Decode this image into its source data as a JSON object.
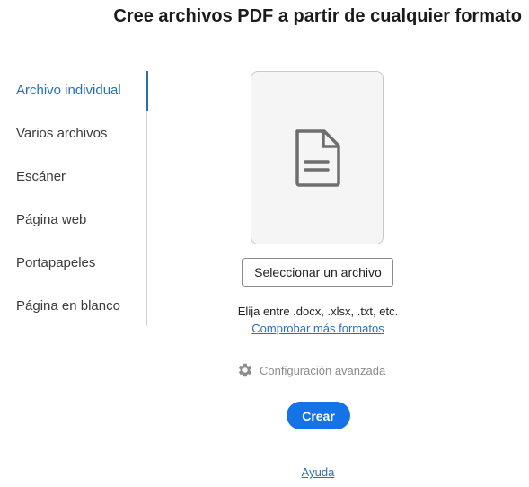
{
  "header": {
    "title": "Cree archivos PDF a partir de cualquier formato"
  },
  "sidebar": {
    "items": [
      {
        "label": "Archivo individual",
        "active": true
      },
      {
        "label": "Varios archivos",
        "active": false
      },
      {
        "label": "Escáner",
        "active": false
      },
      {
        "label": "Página web",
        "active": false
      },
      {
        "label": "Portapapeles",
        "active": false
      },
      {
        "label": "Página en blanco",
        "active": false
      }
    ]
  },
  "main": {
    "dropzone_icon": "document-icon",
    "select_button_label": "Seleccionar un archivo",
    "formats_text": "Elija entre .docx, .xlsx, .txt, etc.",
    "formats_link": "Comprobar más formatos",
    "advanced_settings_label": "Configuración avanzada",
    "advanced_settings_icon": "gear-icon",
    "create_button_label": "Crear",
    "help_link": "Ayuda"
  },
  "colors": {
    "accent": "#1473e6",
    "link": "#2d6fb4",
    "active_tab": "#2a6fb5"
  }
}
